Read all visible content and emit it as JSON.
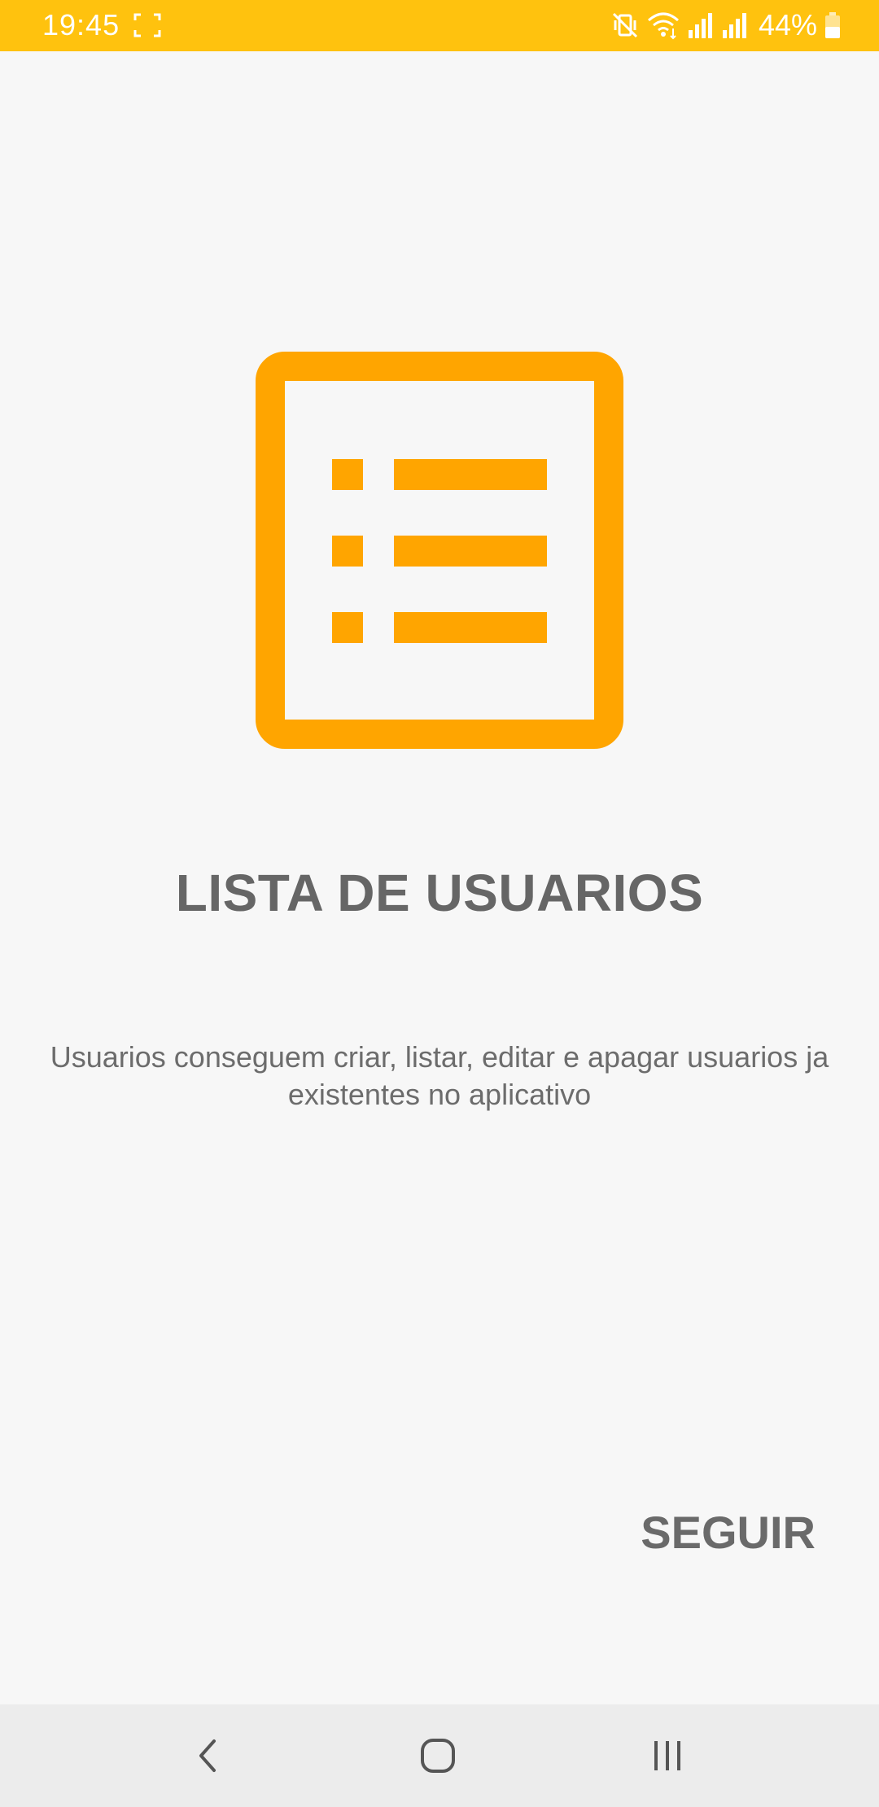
{
  "status_bar": {
    "time": "19:45",
    "battery": "44%",
    "background_color": "#ffc20e",
    "icons": [
      "screenshot-frame-icon",
      "mute-vibrate-icon",
      "wifi-icon",
      "signal-icon",
      "signal-icon",
      "battery-icon"
    ]
  },
  "main": {
    "icon": "list-icon",
    "icon_color": "#ffa500",
    "title": "LISTA DE USUARIOS",
    "description_line1": "Usuarios conseguem criar, listar, editar e apagar usuarios ja",
    "description_line2": "existentes no aplicativo",
    "next_label": "SEGUIR"
  },
  "nav_bar": {
    "buttons": [
      "back-icon",
      "home-icon",
      "recents-icon"
    ]
  }
}
